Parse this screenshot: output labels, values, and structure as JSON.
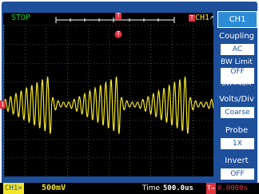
{
  "status": {
    "run_state": "STOP",
    "trigger_ch": "CH1",
    "trigger_edge": "↗"
  },
  "markers": {
    "trigger_pos": "T",
    "ch1_ref": "1"
  },
  "menu": {
    "title": "CH1",
    "items": [
      {
        "label": "Coupling",
        "value": "AC"
      },
      {
        "label": "BW Limit",
        "value": "OFF",
        "extra": "BW=40M"
      },
      {
        "label": "Volts/Div",
        "value": "Coarse"
      },
      {
        "label": "Probe",
        "value": "1X"
      },
      {
        "label": "Invert",
        "value": "OFF"
      }
    ]
  },
  "bottom": {
    "ch_label": "CH1=",
    "volts": "500mV",
    "time_label": "Time",
    "time_value": "500.0us",
    "trig_label": "T→",
    "trig_value": "0.0000s"
  },
  "colors": {
    "frame": "#1d4f9a",
    "trace": "#f2e526",
    "grid": "#7a7a7a",
    "status_green": "#1fcc3a",
    "marker_red": "#e0353f"
  }
}
